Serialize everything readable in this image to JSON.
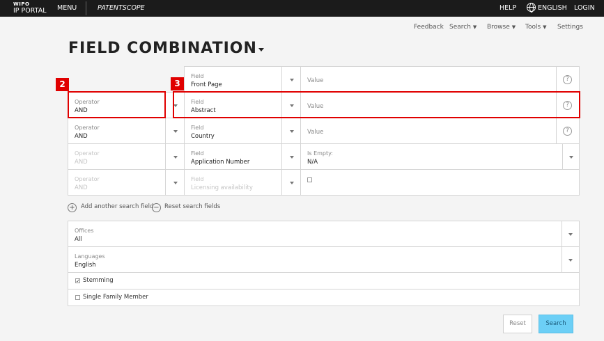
{
  "topbar": {
    "logo_line1": "WIPO",
    "logo_line2": "IP PORTAL",
    "menu": "MENU",
    "brand": "PATENTSCOPE",
    "help": "HELP",
    "language": "ENGLISH",
    "login": "LOGIN"
  },
  "subnav": {
    "feedback": "Feedback",
    "search": "Search",
    "browse": "Browse",
    "tools": "Tools",
    "settings": "Settings"
  },
  "page_title": "FIELD COMBINATION",
  "badges": {
    "operator_highlight": "2",
    "field_highlight": "3"
  },
  "rows": [
    {
      "operator_label": "",
      "operator_value": "",
      "field_label": "Field",
      "field_value": "Front Page",
      "value_placeholder": "Value"
    },
    {
      "operator_label": "Operator",
      "operator_value": "AND",
      "field_label": "Field",
      "field_value": "Abstract",
      "value_placeholder": "Value"
    },
    {
      "operator_label": "Operator",
      "operator_value": "AND",
      "field_label": "Field",
      "field_value": "Country",
      "value_placeholder": "Value"
    },
    {
      "operator_label": "Operator",
      "operator_value": "AND",
      "field_label": "Field",
      "field_value": "Application Number",
      "value_label": "Is Empty:",
      "value_value": "N/A"
    },
    {
      "operator_label": "Operator",
      "operator_value": "AND",
      "field_label": "Field",
      "field_value": "Licensing availability"
    }
  ],
  "actions": {
    "add": "Add another search field",
    "reset": "Reset search fields"
  },
  "offices": {
    "label": "Offices",
    "value": "All"
  },
  "languages": {
    "label": "Languages",
    "value": "English"
  },
  "options": {
    "stemming": "Stemming",
    "single_family": "Single Family Member"
  },
  "buttons": {
    "reset": "Reset",
    "search": "Search"
  },
  "colors": {
    "highlight": "#e00000",
    "search_button": "#6ccff6"
  }
}
